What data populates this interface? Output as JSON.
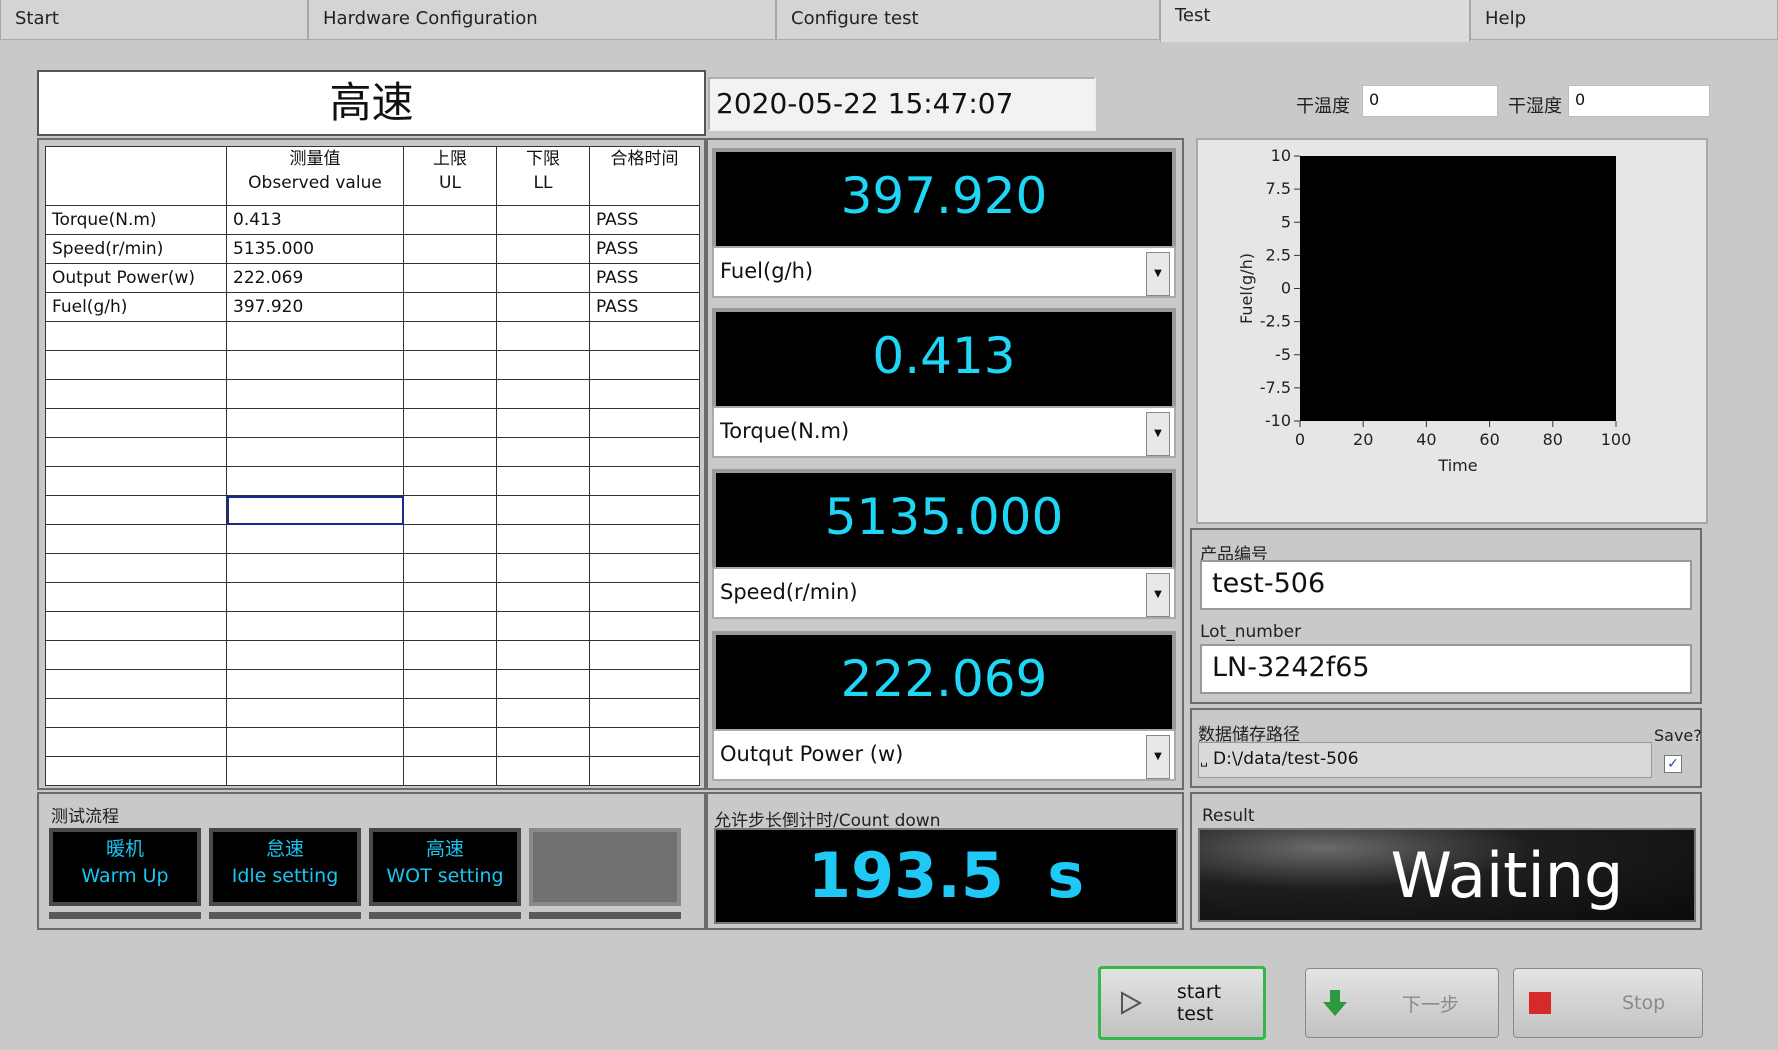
{
  "tabs": [
    {
      "label": "Start"
    },
    {
      "label": "Hardware Configuration"
    },
    {
      "label": "Configure test"
    },
    {
      "label": "Test"
    },
    {
      "label": "Help"
    }
  ],
  "header": {
    "mode_title": "高速",
    "datetime": "2020-05-22 15:47:07",
    "dry_temp_label": "干温度",
    "dry_temp_value": "0",
    "dry_humidity_label": "干湿度",
    "dry_humidity_value": "0"
  },
  "results_table": {
    "headers": [
      {
        "line1": "",
        "line2": ""
      },
      {
        "line1": "测量值",
        "line2": "Observed value"
      },
      {
        "line1": "上限",
        "line2": "UL"
      },
      {
        "line1": "下限",
        "line2": "LL"
      },
      {
        "line1": "合格时间",
        "line2": ""
      }
    ],
    "rows": [
      [
        "Torque(N.m)",
        "0.413",
        "",
        "",
        "PASS"
      ],
      [
        "Speed(r/min)",
        "5135.000",
        "",
        "",
        "PASS"
      ],
      [
        "Output Power(w)",
        "222.069",
        "",
        "",
        "PASS"
      ],
      [
        "Fuel(g/h)",
        "397.920",
        "",
        "",
        "PASS"
      ]
    ]
  },
  "displays": [
    {
      "value": "397.920",
      "channel": "Fuel(g/h)"
    },
    {
      "value": "0.413",
      "channel": "Torque(N.m)"
    },
    {
      "value": "5135.000",
      "channel": "Speed(r/min)"
    },
    {
      "value": "222.069",
      "channel": "Outqut Power (w)"
    }
  ],
  "chart_data": {
    "type": "line",
    "ylabel": "Fuel(g/h)",
    "xlabel": "Time",
    "xlim": [
      0,
      100
    ],
    "ylim": [
      -10,
      10
    ],
    "x_ticks": [
      "0",
      "20",
      "40",
      "60",
      "80",
      "100"
    ],
    "y_ticks": [
      "10",
      "7.5",
      "5",
      "2.5",
      "0",
      "-2.5",
      "-5",
      "-7.5",
      "-10"
    ],
    "series": [],
    "background": "#000000"
  },
  "product": {
    "product_id_label": "产品编号",
    "product_id_value": "test-506",
    "lot_label": "Lot_number",
    "lot_value": "LN-3242f65",
    "path_label": "数据储存路径",
    "path_value": "D:\\/data/test-506",
    "path_icon": "path-browse-icon",
    "save_label": "Save?",
    "save_checked": true
  },
  "sequence": {
    "label": "测试流程",
    "steps": [
      {
        "cn": "暖机",
        "en": "Warm Up"
      },
      {
        "cn": "怠速",
        "en": "Idle setting"
      },
      {
        "cn": "高速",
        "en": "WOT setting"
      },
      {
        "cn": "",
        "en": ""
      }
    ]
  },
  "countdown": {
    "label": "允许步长倒计时/Count down",
    "value": "193.5",
    "unit": "s"
  },
  "result": {
    "label": "Result",
    "value": "Waiting"
  },
  "buttons": {
    "start": "start test",
    "next": "下一步",
    "stop": "Stop"
  },
  "colors": {
    "display_text": "#1fd6f5",
    "start_border": "#34b84a",
    "stop_icon": "#d62a2a",
    "next_icon": "#2c9a3c"
  }
}
